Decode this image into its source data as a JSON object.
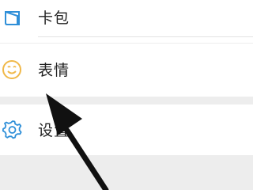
{
  "menu": {
    "items": [
      {
        "label": "卡包",
        "icon": "card-wallet-icon",
        "color": "#2f8fd8"
      },
      {
        "label": "表情",
        "icon": "smiley-icon",
        "color": "#f0b848"
      },
      {
        "label": "设置",
        "icon": "gear-icon",
        "color": "#2f8fd8"
      }
    ]
  },
  "colors": {
    "background": "#ededed",
    "row": "#ffffff",
    "text": "#222222",
    "arrow": "#111111"
  }
}
